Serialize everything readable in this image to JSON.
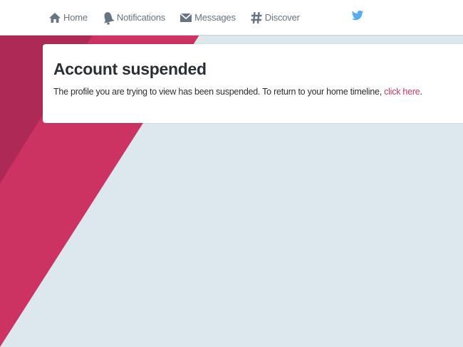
{
  "nav": {
    "items": [
      {
        "label": "Home",
        "icon": "home-icon"
      },
      {
        "label": "Notifications",
        "icon": "bell-icon"
      },
      {
        "label": "Messages",
        "icon": "envelope-icon"
      },
      {
        "label": "Discover",
        "icon": "hashtag-icon"
      }
    ],
    "logo_icon": "twitter-bird-icon"
  },
  "card": {
    "title": "Account suspended",
    "message": "The profile you are trying to view has been suspended. To return to your home timeline, ",
    "link_label": "click here",
    "trailing": "."
  },
  "colors": {
    "background": "#dde7ee",
    "accent_pink": "#cc3363",
    "accent_dark": "#ac2a55",
    "link": "#c1386a",
    "bird_blue": "#55acee",
    "nav_text": "#66757f"
  }
}
